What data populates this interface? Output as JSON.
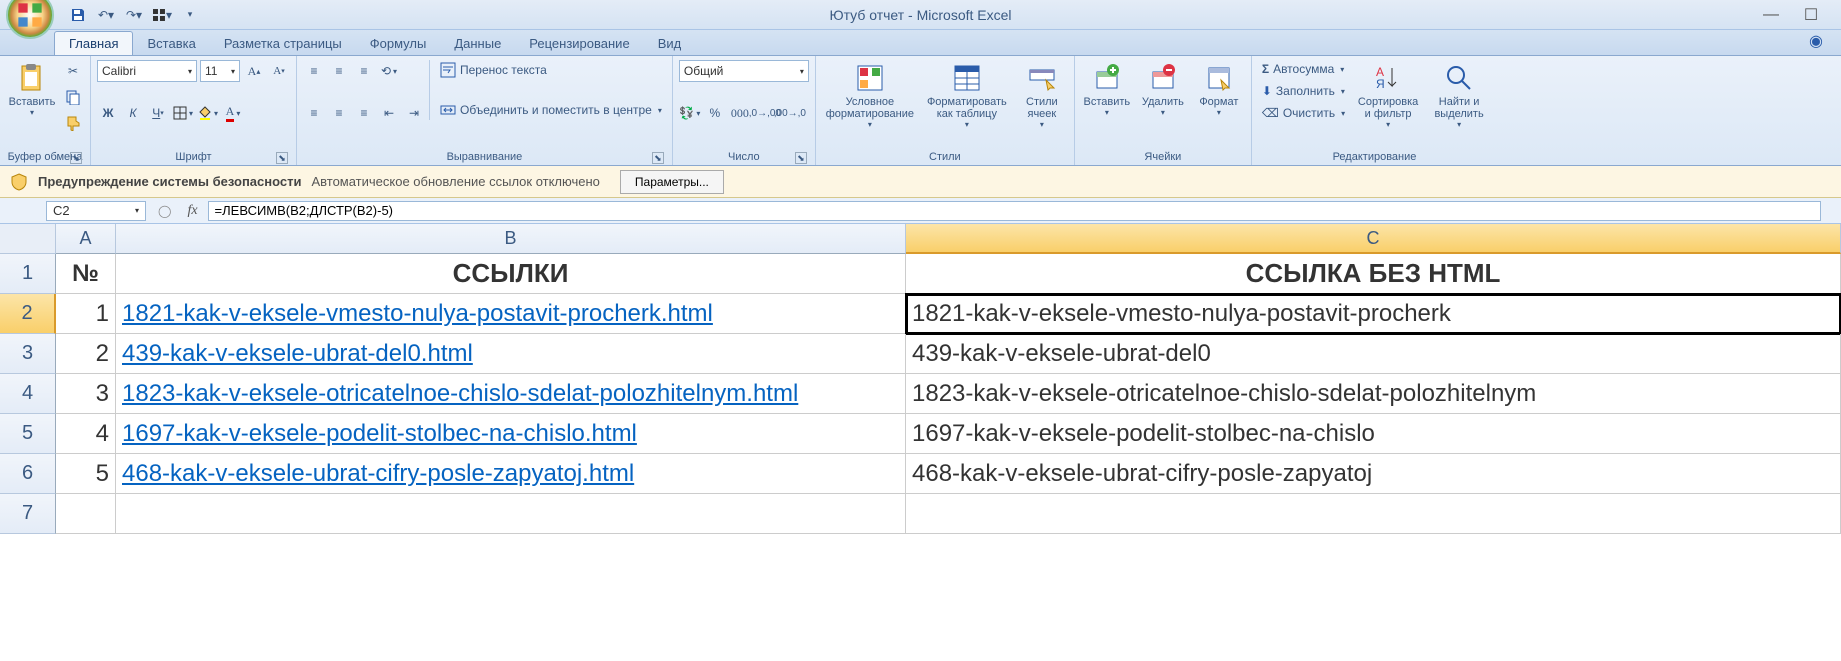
{
  "title": "Ютуб отчет - Microsoft Excel",
  "tabs": [
    "Главная",
    "Вставка",
    "Разметка страницы",
    "Формулы",
    "Данные",
    "Рецензирование",
    "Вид"
  ],
  "ribbon": {
    "clipboard": {
      "paste": "Вставить",
      "label": "Буфер обмена"
    },
    "font": {
      "name": "Calibri",
      "size": "11",
      "label": "Шрифт"
    },
    "alignment": {
      "wrap": "Перенос текста",
      "merge": "Объединить и поместить в центре",
      "label": "Выравнивание"
    },
    "number": {
      "format": "Общий",
      "label": "Число"
    },
    "styles": {
      "cond": "Условное форматирование",
      "table": "Форматировать как таблицу",
      "cell": "Стили ячеек",
      "label": "Стили"
    },
    "cells": {
      "insert": "Вставить",
      "delete": "Удалить",
      "format": "Формат",
      "label": "Ячейки"
    },
    "editing": {
      "sum": "Автосумма",
      "fill": "Заполнить",
      "clear": "Очистить",
      "sort": "Сортировка и фильтр",
      "find": "Найти и выделить",
      "label": "Редактирование"
    }
  },
  "security": {
    "title": "Предупреждение системы безопасности",
    "msg": "Автоматическое обновление ссылок отключено",
    "btn": "Параметры..."
  },
  "formula_bar": {
    "cell": "C2",
    "formula": "=ЛЕВСИМВ(B2;ДЛСТР(B2)-5)"
  },
  "columns": {
    "A": "A",
    "B": "B",
    "C": "C"
  },
  "headers": {
    "A": "№",
    "B": "ССЫЛКИ",
    "C": "ССЫЛКА БЕЗ HTML"
  },
  "rows": [
    {
      "n": "1",
      "link": "1821-kak-v-eksele-vmesto-nulya-postavit-procherk.html",
      "clean": "1821-kak-v-eksele-vmesto-nulya-postavit-procherk"
    },
    {
      "n": "2",
      "link": "439-kak-v-eksele-ubrat-del0.html",
      "clean": "439-kak-v-eksele-ubrat-del0"
    },
    {
      "n": "3",
      "link": "1823-kak-v-eksele-otricatelnoe-chislo-sdelat-polozhitelnym.html",
      "clean": "1823-kak-v-eksele-otricatelnoe-chislo-sdelat-polozhitelnym"
    },
    {
      "n": "4",
      "link": "1697-kak-v-eksele-podelit-stolbec-na-chislo.html",
      "clean": "1697-kak-v-eksele-podelit-stolbec-na-chislo"
    },
    {
      "n": "5",
      "link": "468-kak-v-eksele-ubrat-cifry-posle-zapyatoj.html",
      "clean": "468-kak-v-eksele-ubrat-cifry-posle-zapyatoj"
    }
  ]
}
